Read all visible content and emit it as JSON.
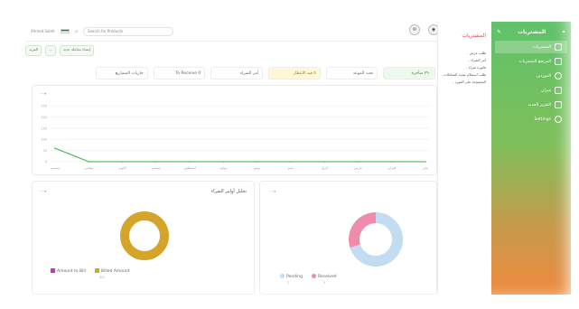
{
  "sidebar": {
    "title": "المشتريات",
    "items": [
      {
        "label": "المشتريات",
        "active": true
      },
      {
        "label": "المرتجع المشتريات",
        "active": false
      },
      {
        "label": "الموردين",
        "active": false
      },
      {
        "label": "ميزان",
        "active": false
      },
      {
        "label": "التقرير الجديد",
        "active": false
      },
      {
        "label": "Settings",
        "active": false
      }
    ],
    "colors": {
      "top": "#5fc26a",
      "bottom": "#ef8a3e"
    }
  },
  "submenu": {
    "title": "المشتريات",
    "items": [
      "- طلب عرض",
      "- أمر الشراء",
      "- فاتورة شراء",
      "- طلب استعلام نقدية المعاملات",
      "- المجموعة على المورد"
    ]
  },
  "topbar": {
    "left_text": "Ahmed Saleh",
    "search_placeholder": "Search for Products",
    "icons": [
      "bell-icon",
      "user-icon"
    ]
  },
  "actions": {
    "new_request": "إنشاء معاملة جديد",
    "more": "...",
    "other": "المزيد"
  },
  "stats": [
    {
      "label": "جاريات المشاريع"
    },
    {
      "label": "To Receive 0"
    },
    {
      "label": "أمر الشراء"
    },
    {
      "label": "٥ قيد الانتظار",
      "tone": "yellow"
    },
    {
      "label": "تحت الموعد"
    },
    {
      "label": "٢٩٠ متأخرة",
      "tone": "green"
    }
  ],
  "chart_data": [
    {
      "type": "line",
      "title": "",
      "x": [
        "يناير",
        "فبراير",
        "مارس",
        "أبريل",
        "مايو",
        "يونيو",
        "يوليو",
        "أغسطس",
        "سبتمبر",
        "أكتوبر",
        "نوفمبر",
        "ديسمبر"
      ],
      "series": [
        {
          "values": [
            0,
            0,
            0,
            0,
            0,
            0,
            0,
            0,
            0,
            0,
            0,
            60
          ]
        }
      ],
      "ylim": [
        0,
        250
      ],
      "yticks": [
        "0",
        "50",
        "100",
        "150",
        "200",
        "250"
      ],
      "color": "#3bb24a",
      "grid": true
    },
    {
      "type": "pie",
      "title": "تحليل أوامر الشراء",
      "series": [
        {
          "name": "Amount to Bill",
          "value": 0,
          "color": "#b042b8"
        },
        {
          "name": "Billed Amount",
          "value": 100,
          "color": "#d4a52a"
        }
      ]
    },
    {
      "type": "pie",
      "title": "",
      "series": [
        {
          "name": "Pending",
          "value": 70,
          "color": "#c2dcf1"
        },
        {
          "name": "Received",
          "value": 30,
          "color": "#f08cab"
        }
      ]
    }
  ],
  "donut1": {
    "legend_sub": "0/0"
  },
  "donut2": {
    "legend_sub_pending": "7",
    "legend_sub_received": "3"
  }
}
